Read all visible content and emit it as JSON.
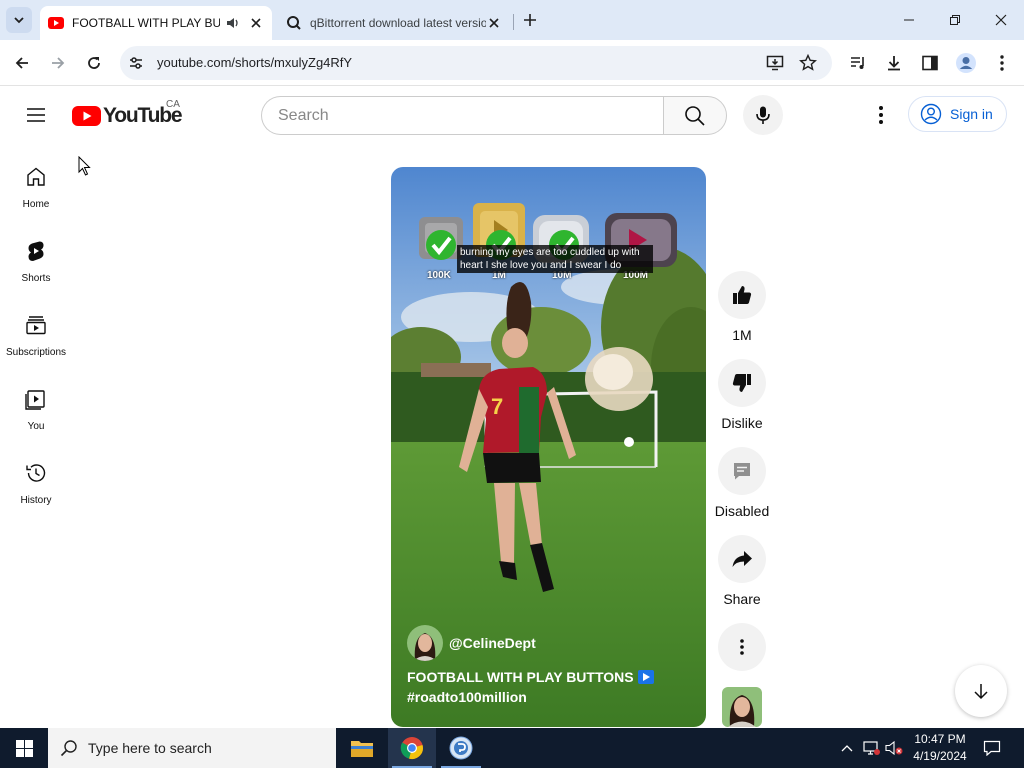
{
  "browser": {
    "tabs": [
      {
        "title": "FOOTBALL WITH PLAY BUTTONS",
        "active": true,
        "audio": true
      },
      {
        "title": "qBittorrent download latest version",
        "active": false
      }
    ],
    "url": "youtube.com/shorts/mxulyZg4RfY"
  },
  "youtube": {
    "country_code": "CA",
    "logo_text": "YouTube",
    "search_placeholder": "Search",
    "signin_label": "Sign in",
    "guide": [
      {
        "label": "Home",
        "icon": "home-icon"
      },
      {
        "label": "Shorts",
        "icon": "shorts-icon"
      },
      {
        "label": "Subscriptions",
        "icon": "subscriptions-icon"
      },
      {
        "label": "You",
        "icon": "you-icon"
      },
      {
        "label": "History",
        "icon": "history-icon"
      }
    ]
  },
  "short": {
    "caption": "burning my eyes are too cuddled up with heart I she love you and I swear I do",
    "milestones": [
      "100K",
      "1M",
      "10M",
      "100M"
    ],
    "channel": "@CelineDept",
    "title_line1": "FOOTBALL WITH PLAY BUTTONS",
    "title_line2": "#roadto100million",
    "jersey_number": "7",
    "actions": {
      "like": "1M",
      "dislike": "Dislike",
      "comments": "Disabled",
      "share": "Share"
    }
  },
  "taskbar": {
    "search_placeholder": "Type here to search",
    "time": "10:47 PM",
    "date": "4/19/2024"
  },
  "colors": {
    "youtube_red": "#ff0000",
    "link_blue": "#065fd4",
    "tab_strip": "#dfe9f7",
    "taskbar": "#0f1b2d"
  }
}
